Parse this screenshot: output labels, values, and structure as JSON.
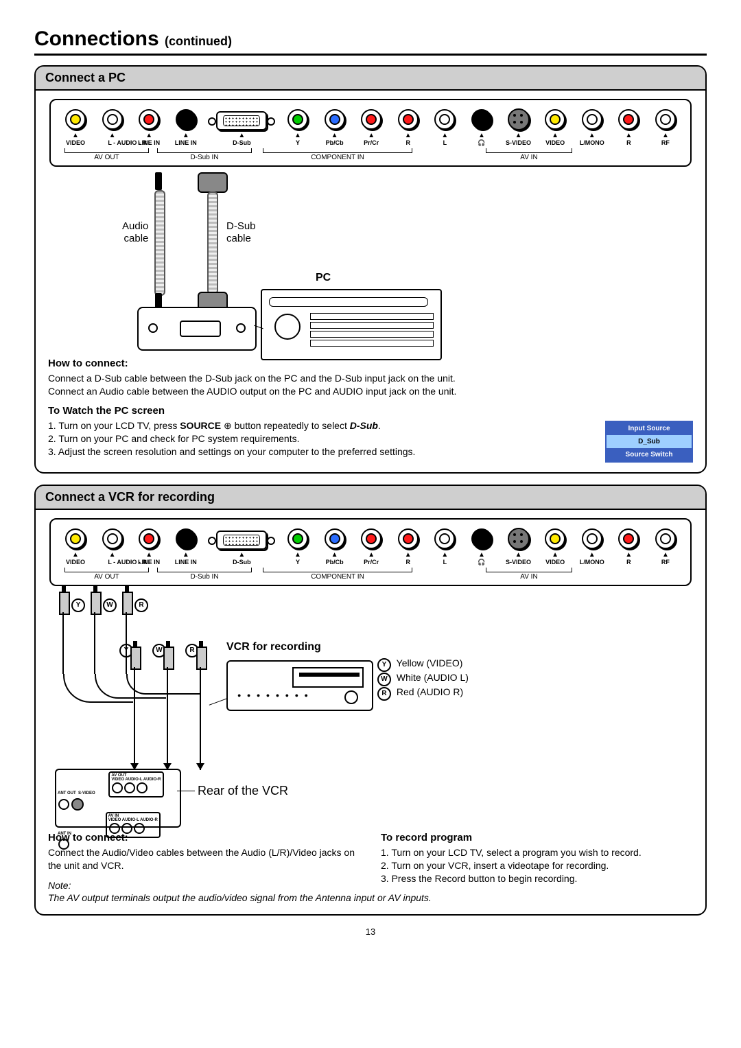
{
  "page": {
    "title": "Connections",
    "title_suffix": "(continued)",
    "number": "13"
  },
  "rear_panel": {
    "port_labels": [
      "VIDEO",
      "L - AUDIO - R",
      "LINE IN",
      "D-Sub",
      "Y",
      "Pb/Cb",
      "Pr/Cr",
      "R",
      "L",
      "🎧",
      "S-VIDEO",
      "VIDEO",
      "L/MONO",
      "R",
      "RF"
    ],
    "groups": {
      "av_out": "AV OUT",
      "dsub_in": "D-Sub IN",
      "component_in": "COMPONENT IN",
      "av_in": "AV IN"
    }
  },
  "section_pc": {
    "header": "Connect a PC",
    "audio_cable": "Audio\ncable",
    "dsub_cable": "D-Sub\ncable",
    "pc_label": "PC",
    "how_to_connect_h": "How to connect:",
    "how_to_connect_1": "Connect a D-Sub cable between the D-Sub jack on the PC and the D-Sub input jack on the unit.",
    "how_to_connect_2": "Connect an Audio cable between the AUDIO output on the PC and AUDIO input jack on the unit.",
    "watch_h": "To Watch the PC screen",
    "watch_1a": "1. Turn on your LCD TV, press ",
    "watch_1b": "SOURCE",
    "watch_1c": " ⊕ button repeatedly to select ",
    "watch_1d": "D-Sub",
    "watch_1e": ".",
    "watch_2": "2. Turn on your PC and check for PC system requirements.",
    "watch_3": "3. Adjust the screen resolution and settings on your computer to the preferred settings.",
    "source_menu": {
      "title": "Input Source",
      "selected": "D_Sub",
      "footer": "Source Switch"
    }
  },
  "section_vcr": {
    "header": "Connect a VCR for recording",
    "vcr_label": "VCR for recording",
    "rear_label": "Rear of the VCR",
    "legend_y": "Yellow (VIDEO)",
    "legend_w": "White (AUDIO L)",
    "legend_r": "Red (AUDIO R)",
    "how_to_connect_h": "How to connect:",
    "how_to_connect_t": "Connect the Audio/Video cables between the Audio (L/R)/Video  jacks on the unit and VCR.",
    "record_h": "To record program",
    "record_1": "1. Turn on your LCD TV, select a program you wish to record.",
    "record_2": "2. Turn on your VCR, insert a videotape for recording.",
    "record_3": "3. Press the Record button to begin recording.",
    "note_h": "Note:",
    "note_t": "The AV output terminals output the audio/video signal from the Antenna input or AV inputs.",
    "rear_ports": {
      "ant_out": "ANT OUT",
      "s_video": "S-VIDEO",
      "ant_in": "ANT IN",
      "av_out": "AV OUT",
      "av_in": "AV IN",
      "video": "VIDEO",
      "audio_l": "AUDIO-L",
      "audio_r": "AUDIO-R"
    }
  }
}
